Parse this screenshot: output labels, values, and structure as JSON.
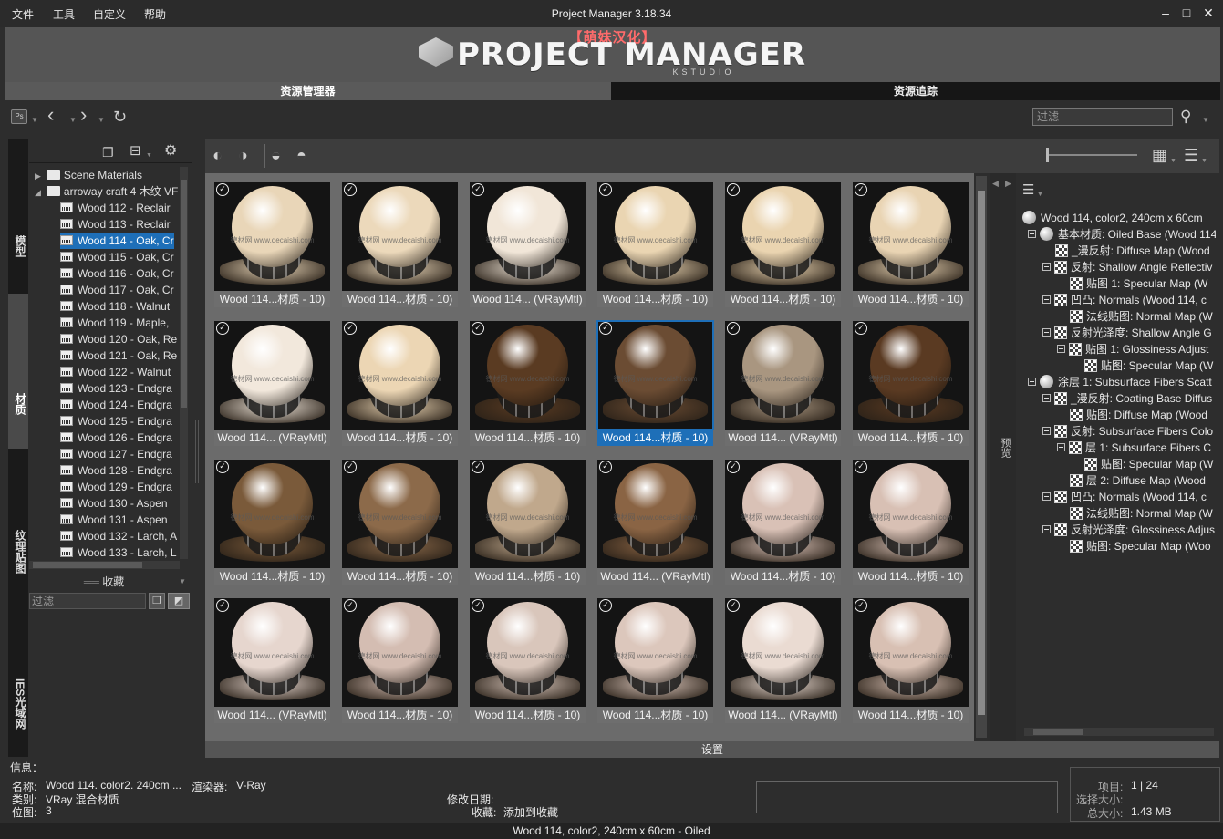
{
  "menu": {
    "items": [
      "文件",
      "工具",
      "自定义",
      "帮助"
    ]
  },
  "window": {
    "title": "Project Manager 3.18.34"
  },
  "banner": {
    "chinese": "【萌妹汉化】",
    "logo": "PROJECT MANAGER",
    "sub": "KSTUDIO"
  },
  "tabs": [
    "资源管理器",
    "资源追踪"
  ],
  "filter_placeholder": "过滤",
  "sidebar_tabs": [
    "模型",
    "材质",
    "纹理贴图",
    "IES光域网"
  ],
  "tree": {
    "roots": [
      "Scene Materials",
      "arroway craft 4 木纹 VF"
    ],
    "items": [
      "Wood 112 - Reclair",
      "Wood 113 - Reclair",
      "Wood 114 - Oak, Cr",
      "Wood 115 - Oak, Cr",
      "Wood 116 - Oak, Cr",
      "Wood 117 - Oak, Cr",
      "Wood 118 - Walnut",
      "Wood 119 - Maple,",
      "Wood 120 - Oak, Re",
      "Wood 121 - Oak, Re",
      "Wood 122 - Walnut",
      "Wood 123 - Endgra",
      "Wood 124 - Endgra",
      "Wood 125 - Endgra",
      "Wood 126 - Endgra",
      "Wood 127 - Endgra",
      "Wood 128 - Endgra",
      "Wood 129 - Endgra",
      "Wood 130 - Aspen",
      "Wood 131 - Aspen",
      "Wood 132 - Larch, A",
      "Wood 133 - Larch, L"
    ]
  },
  "favorites": {
    "header": "收藏",
    "filter": "过滤"
  },
  "watermark": "德材网\nwww.decaishi.com",
  "grid": {
    "items": [
      "Wood 114...材质 - 10)",
      "Wood 114...材质 - 10)",
      "Wood 114... (VRayMtl)",
      "Wood 114...材质 - 10)",
      "Wood 114...材质 - 10)",
      "Wood 114...材质 - 10)",
      "Wood 114... (VRayMtl)",
      "Wood 114...材质 - 10)",
      "Wood 114...材质 - 10)",
      "Wood 114...材质 - 10)",
      "Wood 114... (VRayMtl)",
      "Wood 114...材质 - 10)",
      "Wood 114...材质 - 10)",
      "Wood 114...材质 - 10)",
      "Wood 114...材质 - 10)",
      "Wood 114... (VRayMtl)",
      "Wood 114...材质 - 10)",
      "Wood 114...材质 - 10)",
      "Wood 114... (VRayMtl)",
      "Wood 114...材质 - 10)",
      "Wood 114...材质 - 10)",
      "Wood 114...材质 - 10)",
      "Wood 114... (VRayMtl)",
      "Wood 114...材质 - 10)"
    ],
    "selected_index": 9,
    "colors": [
      "#e9d6b8",
      "#ecd9bb",
      "#f1e6d8",
      "#ead5b2",
      "#ead4b0",
      "#e9d4b3",
      "#f2e8dc",
      "#ecd6b4",
      "#5a3b22",
      "#6b4c33",
      "#a99680",
      "#5a3a22",
      "#7a5a3a",
      "#8c6a4a",
      "#c0a88c",
      "#8a6444",
      "#d9c1b6",
      "#d8c0b4",
      "#e6d6ce",
      "#d4bdb2",
      "#d9c6bb",
      "#dcc7bc",
      "#eadbd2",
      "#d8c0b3"
    ]
  },
  "props": [
    {
      "text": "Wood 114, color2, 240cm x 60cm",
      "icon": "ball",
      "level": 0
    },
    {
      "text": "基本材质: Oiled Base (Wood 114",
      "icon": "ball",
      "level": 1,
      "toggle": true
    },
    {
      "text": "_漫反射: Diffuse Map (Wood",
      "icon": "chk",
      "level": 2
    },
    {
      "text": "反射: Shallow Angle Reflectiv",
      "icon": "chk",
      "level": 2,
      "toggle": true
    },
    {
      "text": "贴图 1: Specular Map (W",
      "icon": "chk",
      "level": 3
    },
    {
      "text": "凹凸: Normals (Wood 114, c",
      "icon": "chk",
      "level": 2,
      "toggle": true
    },
    {
      "text": "法线贴图: Normal Map (W",
      "icon": "chk",
      "level": 3
    },
    {
      "text": "反射光泽度: Shallow Angle G",
      "icon": "chk",
      "level": 2,
      "toggle": true
    },
    {
      "text": "贴图 1: Glossiness Adjust",
      "icon": "chk",
      "level": 3,
      "toggle": true
    },
    {
      "text": "贴图: Specular Map (W",
      "icon": "chk",
      "level": 4
    },
    {
      "text": "涂层 1: Subsurface Fibers Scatt",
      "icon": "ball",
      "level": 1,
      "toggle": true
    },
    {
      "text": "_漫反射: Coating Base Diffus",
      "icon": "chk",
      "level": 2,
      "toggle": true
    },
    {
      "text": "贴图: Diffuse Map (Wood",
      "icon": "chk",
      "level": 3
    },
    {
      "text": "反射: Subsurface Fibers Colo",
      "icon": "chk",
      "level": 2,
      "toggle": true
    },
    {
      "text": "层 1: Subsurface Fibers C",
      "icon": "chk",
      "level": 3,
      "toggle": true
    },
    {
      "text": "贴图: Specular Map (W",
      "icon": "chk",
      "level": 4
    },
    {
      "text": "层 2: Diffuse Map (Wood",
      "icon": "chk",
      "level": 3
    },
    {
      "text": "凹凸: Normals (Wood 114, c",
      "icon": "chk",
      "level": 2,
      "toggle": true
    },
    {
      "text": "法线贴图: Normal Map (W",
      "icon": "chk",
      "level": 3
    },
    {
      "text": "反射光泽度: Glossiness Adjus",
      "icon": "chk",
      "level": 2,
      "toggle": true
    },
    {
      "text": "贴图: Specular Map (Woo",
      "icon": "chk",
      "level": 3
    }
  ],
  "preview_tab": "预览",
  "settings": "设置",
  "info": {
    "header": "信息：",
    "name_label": "名称:",
    "name": "Wood 114. color2. 240cm ...",
    "renderer_label": "渲染器:",
    "renderer": "V-Ray",
    "type_label": "类别:",
    "type": "VRay 混合材质",
    "pos_label": "位图:",
    "pos": "3",
    "modified_label": "修改日期:",
    "modified": "",
    "fav_label": "收藏:",
    "fav": "添加到收藏",
    "items_label": "项目:",
    "items": "1 | 24",
    "selsize_label": "选择大小:",
    "selsize": "",
    "totalsize_label": "总大小:",
    "totalsize": "1.43 MB"
  },
  "status": "Wood 114, color2, 240cm x 60cm - Oiled"
}
